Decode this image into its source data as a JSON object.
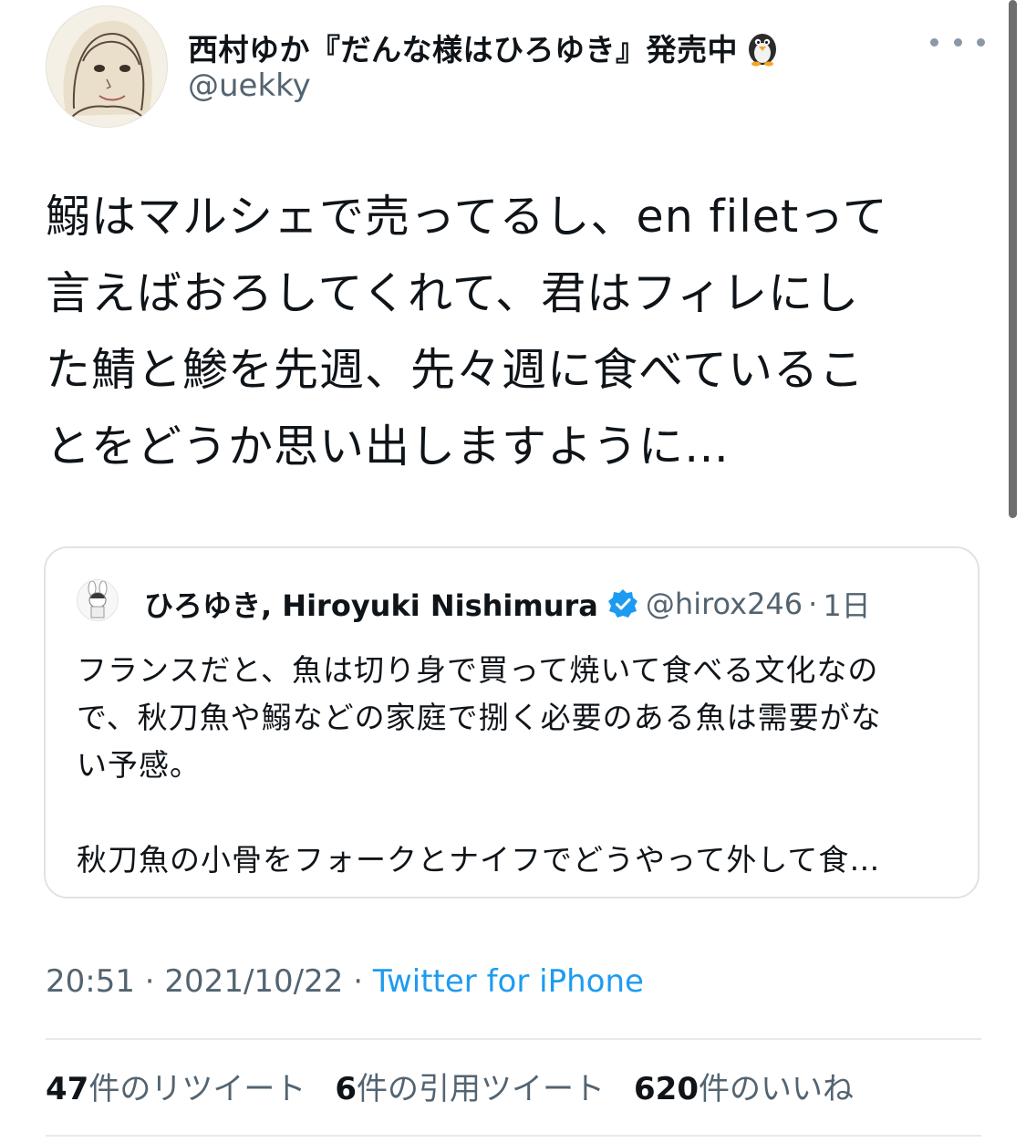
{
  "author": {
    "display_name": "西村ゆか『だんな様はひろゆき』発売中",
    "emoji": "penguin-emoji",
    "handle": "@uekky"
  },
  "tweet": {
    "lines": [
      "鰯はマルシェで売ってるし、en filetって",
      "言えばおろしてくれて、君はフィレにし",
      "た鯖と鯵を先週、先々週に食べているこ",
      "とをどうか思い出しますように…"
    ]
  },
  "quoted_tweet": {
    "display_name": "ひろゆき, Hiroyuki Nishimura",
    "verified": true,
    "handle": "@hirox246",
    "separator": "·",
    "time": "1日",
    "lines": [
      "フランスだと、魚は切り身で買って焼いて食べる文化なの",
      "で、秋刀魚や鰯などの家庭で捌く必要のある魚は需要がな",
      "い予感。",
      "",
      "秋刀魚の小骨をフォークとナイフでどうやって外して食…"
    ]
  },
  "meta": {
    "time": "20:51",
    "date": "2021/10/22",
    "separator": "·",
    "source": "Twitter for iPhone"
  },
  "stats": {
    "retweets_count": "47",
    "retweets_label": "件のリツイート",
    "quotes_count": "6",
    "quotes_label": "件の引用ツイート",
    "likes_count": "620",
    "likes_label": "件のいいね"
  },
  "colors": {
    "secondary_text": "#536471",
    "link": "#1d9bf0",
    "verified": "#1d9bf0"
  }
}
